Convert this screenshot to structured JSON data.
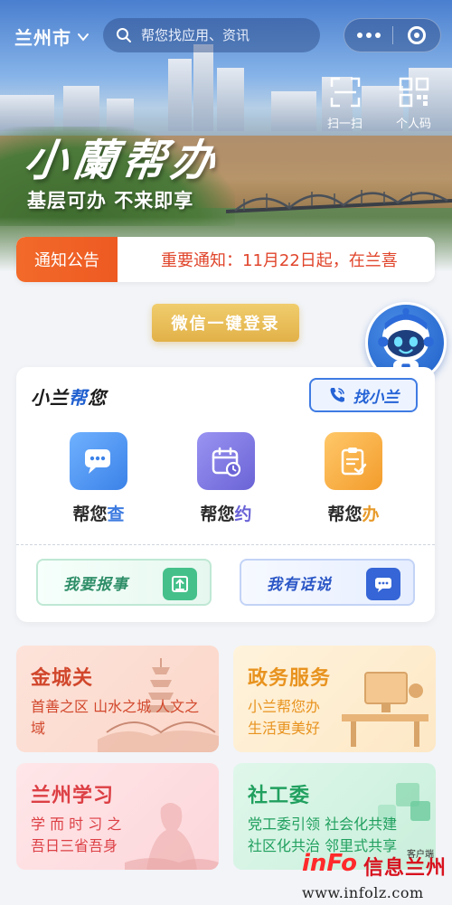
{
  "header": {
    "city": "兰州市",
    "search_placeholder": "帮您找应用、资讯",
    "quick_actions": [
      {
        "label": "扫一扫",
        "icon": "scan-icon"
      },
      {
        "label": "个人码",
        "icon": "qrcode-icon"
      }
    ]
  },
  "banner": {
    "brand": "小蘭帮办",
    "slogan": "基层可办 不来即享"
  },
  "notice": {
    "tag": "通知公告",
    "message": "重要通知：11月22日起，在兰喜"
  },
  "login": {
    "label": "微信一键登录"
  },
  "help_card": {
    "title_prefix": "小兰",
    "title_highlight": "帮",
    "title_suffix": "您",
    "find_button": "找小兰",
    "services": [
      {
        "prefix": "帮您",
        "highlight": "查",
        "color": "#3d7be0",
        "icon": "chat-icon"
      },
      {
        "prefix": "帮您",
        "highlight": "约",
        "color": "#6a63d6",
        "icon": "calendar-icon"
      },
      {
        "prefix": "帮您",
        "highlight": "办",
        "color": "#e79a2a",
        "icon": "clipboard-icon"
      }
    ],
    "actions": [
      {
        "label": "我要报事",
        "icon": "upload-icon"
      },
      {
        "label": "我有话说",
        "icon": "message-icon"
      }
    ]
  },
  "tiles": [
    {
      "title": "金城关",
      "subtitle": "首善之区 山水之城 人文之域"
    },
    {
      "title": "政务服务",
      "subtitle": "小兰帮您办\n生活更美好"
    },
    {
      "title": "兰州学习",
      "subtitle": "学 而 时 习 之\n吾日三省吾身"
    },
    {
      "title": "社工委",
      "subtitle": "党工委引领 社会化共建\n社区化共治 邻里式共享"
    }
  ],
  "watermark": {
    "logo": "inFo",
    "name": "信息兰州",
    "client": "客户端",
    "url": "www.infolz.com"
  },
  "colors": {
    "notice_tag": "#ee5a22",
    "notice_text": "#e0452b",
    "login_gold": "#e2b148",
    "primary_blue": "#2563d6"
  }
}
